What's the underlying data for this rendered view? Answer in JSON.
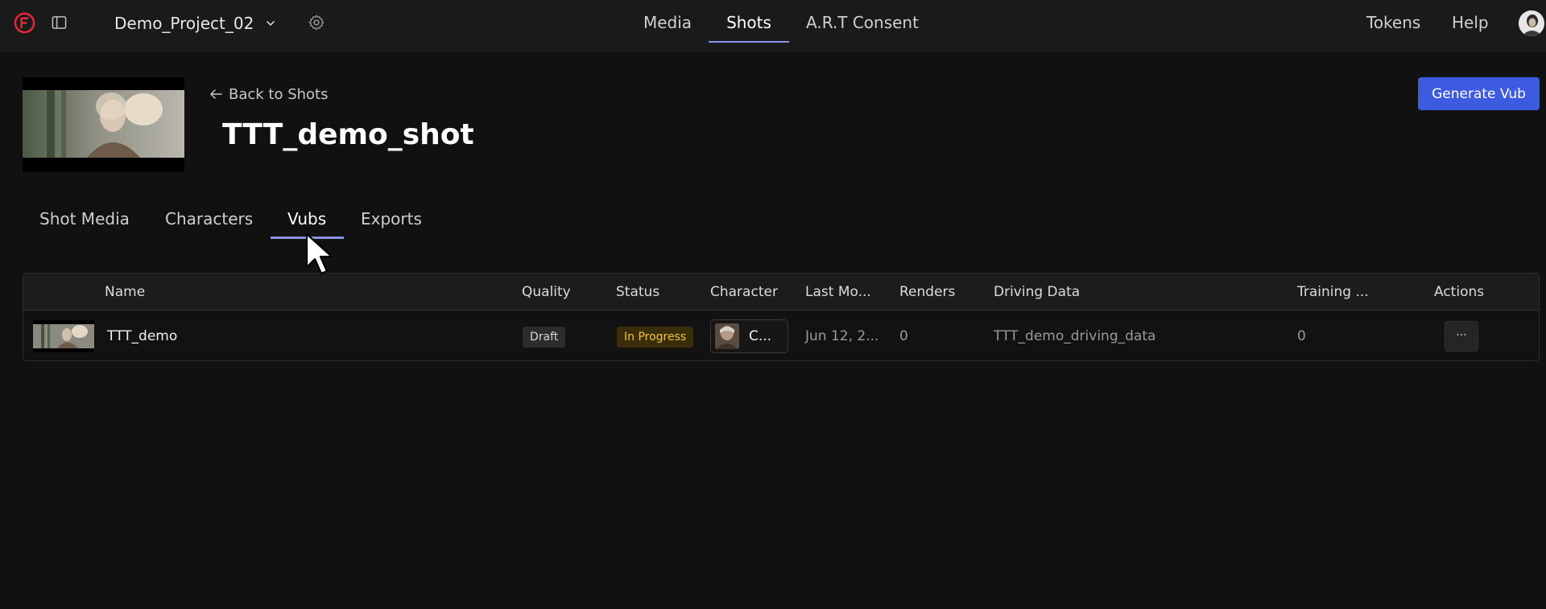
{
  "topbar": {
    "project_name": "Demo_Project_02",
    "nav": [
      {
        "label": "Media",
        "active": false
      },
      {
        "label": "Shots",
        "active": true
      },
      {
        "label": "A.R.T Consent",
        "active": false
      }
    ],
    "right_links": [
      "Tokens",
      "Help"
    ],
    "icons": {
      "logo": "brand-logo-icon",
      "sidebar": "sidebar-toggle-icon",
      "settings": "gear-icon",
      "chevron": "chevron-down-icon"
    }
  },
  "header": {
    "back_label": "Back to Shots",
    "title": "TTT_demo_shot",
    "generate_label": "Generate Vub"
  },
  "tabs": [
    {
      "label": "Shot Media",
      "active": false
    },
    {
      "label": "Characters",
      "active": false
    },
    {
      "label": "Vubs",
      "active": true
    },
    {
      "label": "Exports",
      "active": false
    }
  ],
  "table": {
    "columns": [
      "Name",
      "Quality",
      "Status",
      "Character",
      "Last Mo...",
      "Renders",
      "Driving Data",
      "Training ...",
      "Actions"
    ],
    "rows": [
      {
        "name": "TTT_demo",
        "quality": "Draft",
        "status": "In Progress",
        "character": "C...",
        "last_modified": "Jun 12, 2...",
        "renders": "0",
        "driving_data": "TTT_demo_driving_data",
        "training": "0",
        "actions": "···"
      }
    ]
  },
  "colors": {
    "background": "#111111",
    "topbar": "#1a1a1a",
    "accent_underline": "#8b93e8",
    "primary_button": "#3d5be0",
    "status_in_progress": "#f2c23a",
    "brand_red": "#e0283a"
  }
}
